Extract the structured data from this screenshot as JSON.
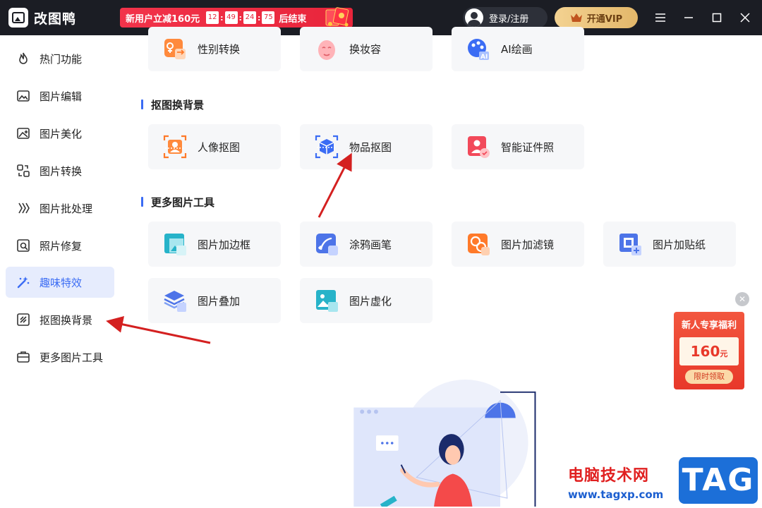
{
  "app": {
    "name": "改图鸭"
  },
  "promo": {
    "text": "新用户立减160元",
    "timer": [
      "12",
      "49",
      "24",
      "75"
    ],
    "suffix": "后结束"
  },
  "header": {
    "login_label": "登录/注册",
    "vip_label": "开通VIP"
  },
  "sidebar": {
    "items": [
      {
        "label": "热门功能",
        "icon": "flame-icon"
      },
      {
        "label": "图片编辑",
        "icon": "image-edit-icon"
      },
      {
        "label": "图片美化",
        "icon": "image-beautify-icon"
      },
      {
        "label": "图片转换",
        "icon": "convert-icon"
      },
      {
        "label": "图片批处理",
        "icon": "batch-icon"
      },
      {
        "label": "照片修复",
        "icon": "photo-repair-icon"
      },
      {
        "label": "趣味特效",
        "icon": "magic-wand-icon",
        "active": true
      },
      {
        "label": "抠图换背景",
        "icon": "cutout-icon"
      },
      {
        "label": "更多图片工具",
        "icon": "toolbox-icon"
      }
    ]
  },
  "sections": {
    "top_row": [
      {
        "label": "性别转换",
        "icon": "gender-swap-icon"
      },
      {
        "label": "换妆容",
        "icon": "makeup-icon"
      },
      {
        "label": "AI绘画",
        "icon": "ai-paint-icon"
      }
    ],
    "cutout": {
      "title": "抠图换背景",
      "items": [
        {
          "label": "人像抠图",
          "icon": "portrait-cutout-icon"
        },
        {
          "label": "物品抠图",
          "icon": "object-cutout-icon"
        },
        {
          "label": "智能证件照",
          "icon": "id-photo-icon"
        }
      ]
    },
    "more": {
      "title": "更多图片工具",
      "items": [
        {
          "label": "图片加边框",
          "icon": "frame-icon"
        },
        {
          "label": "涂鸦画笔",
          "icon": "brush-icon"
        },
        {
          "label": "图片加滤镜",
          "icon": "filter-icon"
        },
        {
          "label": "图片加贴纸",
          "icon": "sticker-icon"
        },
        {
          "label": "图片叠加",
          "icon": "layers-icon"
        },
        {
          "label": "图片虚化",
          "icon": "blur-icon"
        }
      ]
    }
  },
  "float_promo": {
    "title": "新人专享福利",
    "amount": "160",
    "unit": "元",
    "claim": "限时领取"
  },
  "watermark": {
    "text": "电脑技术网",
    "url": "www.tagxp.com",
    "tag": "TAG"
  },
  "colors": {
    "accent": "#3b6cf4",
    "titlebar": "#1b1d24",
    "promo_red": "#e8253b",
    "vip_gold": "#e3b76a",
    "annotation_arrow": "#d42020"
  }
}
